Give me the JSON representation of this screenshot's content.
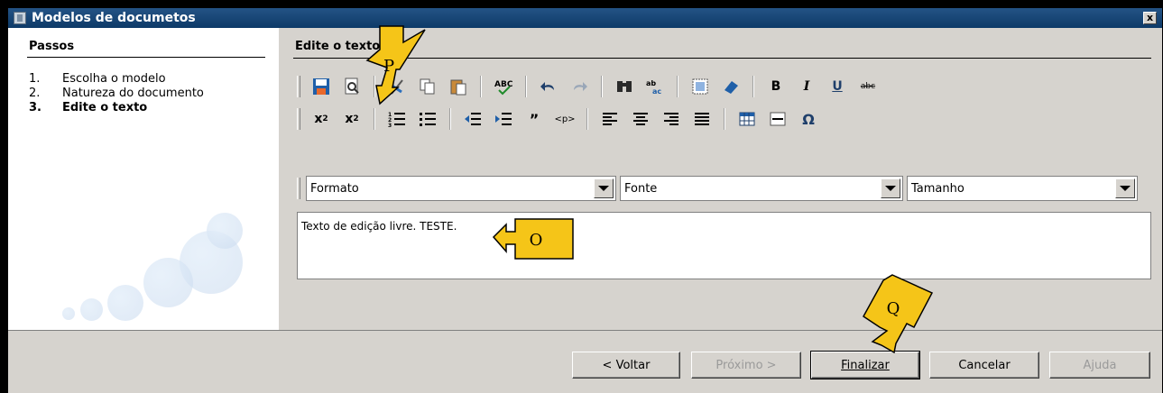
{
  "window": {
    "title": "Modelos de documetos",
    "close_label": "x"
  },
  "left": {
    "heading": "Passos",
    "steps": [
      {
        "num": "1.",
        "label": "Escolha o modelo"
      },
      {
        "num": "2.",
        "label": "Natureza do documento"
      },
      {
        "num": "3.",
        "label": "Edite o texto"
      }
    ]
  },
  "right": {
    "heading": "Edite o texto",
    "combos": {
      "format": "Formato",
      "font": "Fonte",
      "size": "Tamanho"
    },
    "editor_text": "Texto de edição livre. TESTE."
  },
  "buttons": {
    "back": "< Voltar",
    "next": "Próximo >",
    "finish": "Finalizar",
    "cancel": "Cancelar",
    "help": "Ajuda"
  },
  "callouts": {
    "p": "P",
    "o": "O",
    "q": "Q"
  },
  "colors": {
    "titlebar": "#245385",
    "callout": "#f5c518",
    "panel": "#d6d3ce"
  }
}
